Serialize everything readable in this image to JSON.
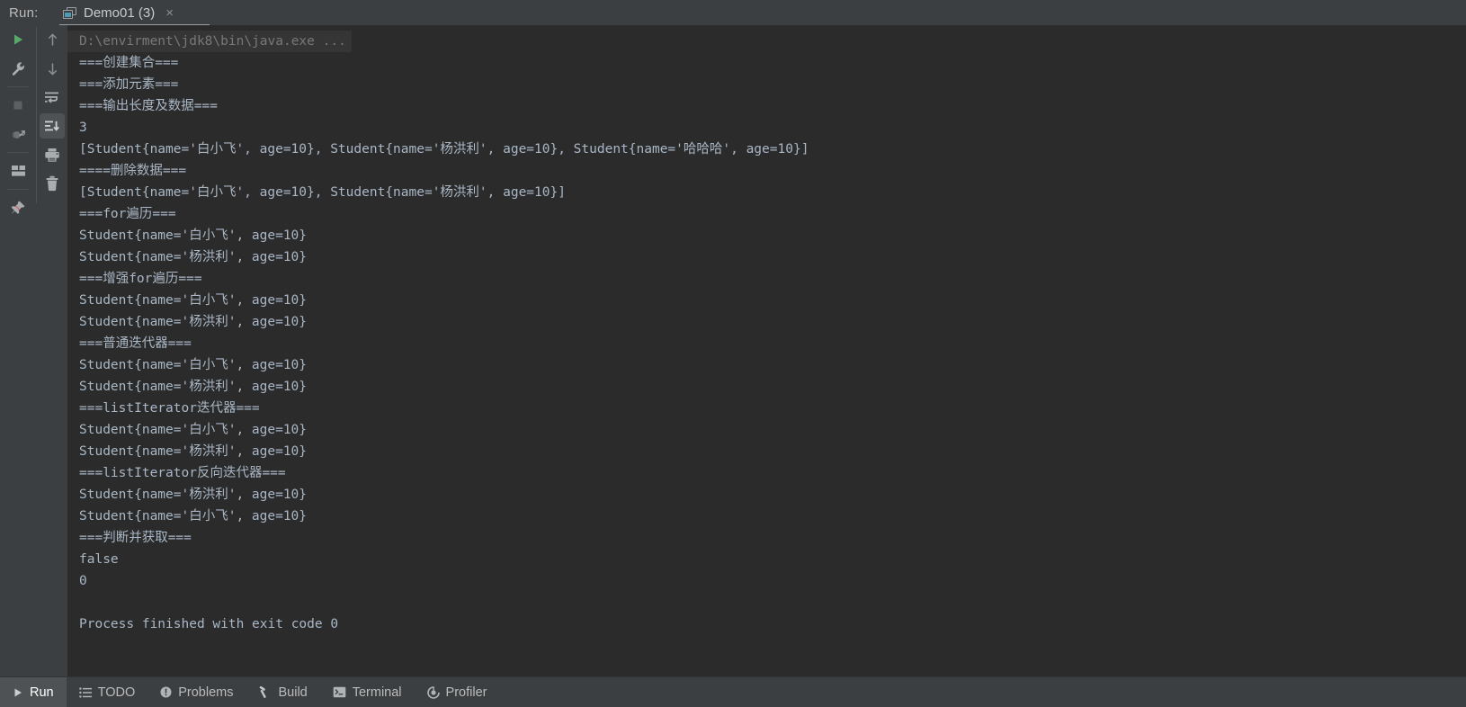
{
  "header": {
    "run_label": "Run:",
    "tab_title": "Demo01 (3)",
    "tab_close": "×",
    "tab_icon": "window-icon"
  },
  "toolbar_primary": [
    {
      "name": "rerun-button",
      "icon": "play-icon",
      "label": "Rerun"
    },
    {
      "name": "edit-configurations-button",
      "icon": "wrench-icon",
      "label": "Edit Configurations"
    },
    {
      "name": "stop-button",
      "icon": "stop-square-icon",
      "label": "Stop"
    },
    {
      "name": "attach-debugger-button",
      "icon": "bug-attach-icon",
      "label": "Attach Debugger"
    },
    {
      "name": "layout-button",
      "icon": "layout-icon",
      "label": "Layout"
    },
    {
      "name": "pin-tab-button",
      "icon": "pin-icon",
      "label": "Pin Tab"
    }
  ],
  "toolbar_secondary": [
    {
      "name": "up-stack-trace-button",
      "icon": "arrow-up-icon",
      "label": "Up the Stack Trace"
    },
    {
      "name": "down-stack-trace-button",
      "icon": "arrow-down-icon",
      "label": "Down the Stack Trace"
    },
    {
      "name": "soft-wrap-button",
      "icon": "soft-wrap-icon",
      "label": "Soft-Wrap"
    },
    {
      "name": "scroll-to-end-button",
      "icon": "scroll-to-end-icon",
      "label": "Scroll to the end",
      "active": true
    },
    {
      "name": "print-button",
      "icon": "printer-icon",
      "label": "Print"
    },
    {
      "name": "clear-all-button",
      "icon": "trash-icon",
      "label": "Clear All"
    }
  ],
  "console": {
    "command_line": "D:\\envirment\\jdk8\\bin\\java.exe ...",
    "lines": [
      "===创建集合===",
      "===添加元素===",
      "===输出长度及数据===",
      "3",
      "[Student{name='白小飞', age=10}, Student{name='杨洪利', age=10}, Student{name='哈哈哈', age=10}]",
      "====删除数据===",
      "[Student{name='白小飞', age=10}, Student{name='杨洪利', age=10}]",
      "===for遍历===",
      "Student{name='白小飞', age=10}",
      "Student{name='杨洪利', age=10}",
      "===增强for遍历===",
      "Student{name='白小飞', age=10}",
      "Student{name='杨洪利', age=10}",
      "===普通迭代器===",
      "Student{name='白小飞', age=10}",
      "Student{name='杨洪利', age=10}",
      "===listIterator迭代器===",
      "Student{name='白小飞', age=10}",
      "Student{name='杨洪利', age=10}",
      "===listIterator反向迭代器===",
      "Student{name='杨洪利', age=10}",
      "Student{name='白小飞', age=10}",
      "===判断并获取===",
      "false",
      "0",
      "",
      "Process finished with exit code 0"
    ]
  },
  "status_bar": {
    "tabs": [
      {
        "name": "status-tab-run",
        "label": "Run",
        "icon": "play-icon",
        "active": true
      },
      {
        "name": "status-tab-todo",
        "label": "TODO",
        "icon": "list-icon",
        "active": false
      },
      {
        "name": "status-tab-problems",
        "label": "Problems",
        "icon": "warning-icon",
        "active": false
      },
      {
        "name": "status-tab-build",
        "label": "Build",
        "icon": "hammer-icon",
        "active": false
      },
      {
        "name": "status-tab-terminal",
        "label": "Terminal",
        "icon": "terminal-icon",
        "active": false
      },
      {
        "name": "status-tab-profiler",
        "label": "Profiler",
        "icon": "profiler-icon",
        "active": false
      }
    ]
  },
  "colors": {
    "panel_bg": "#3c3f41",
    "console_bg": "#2b2b2b",
    "console_text": "#a9b7c6",
    "command_text": "#787878",
    "accent_green": "#59a869",
    "tab_underline": "#9a9fa2"
  }
}
